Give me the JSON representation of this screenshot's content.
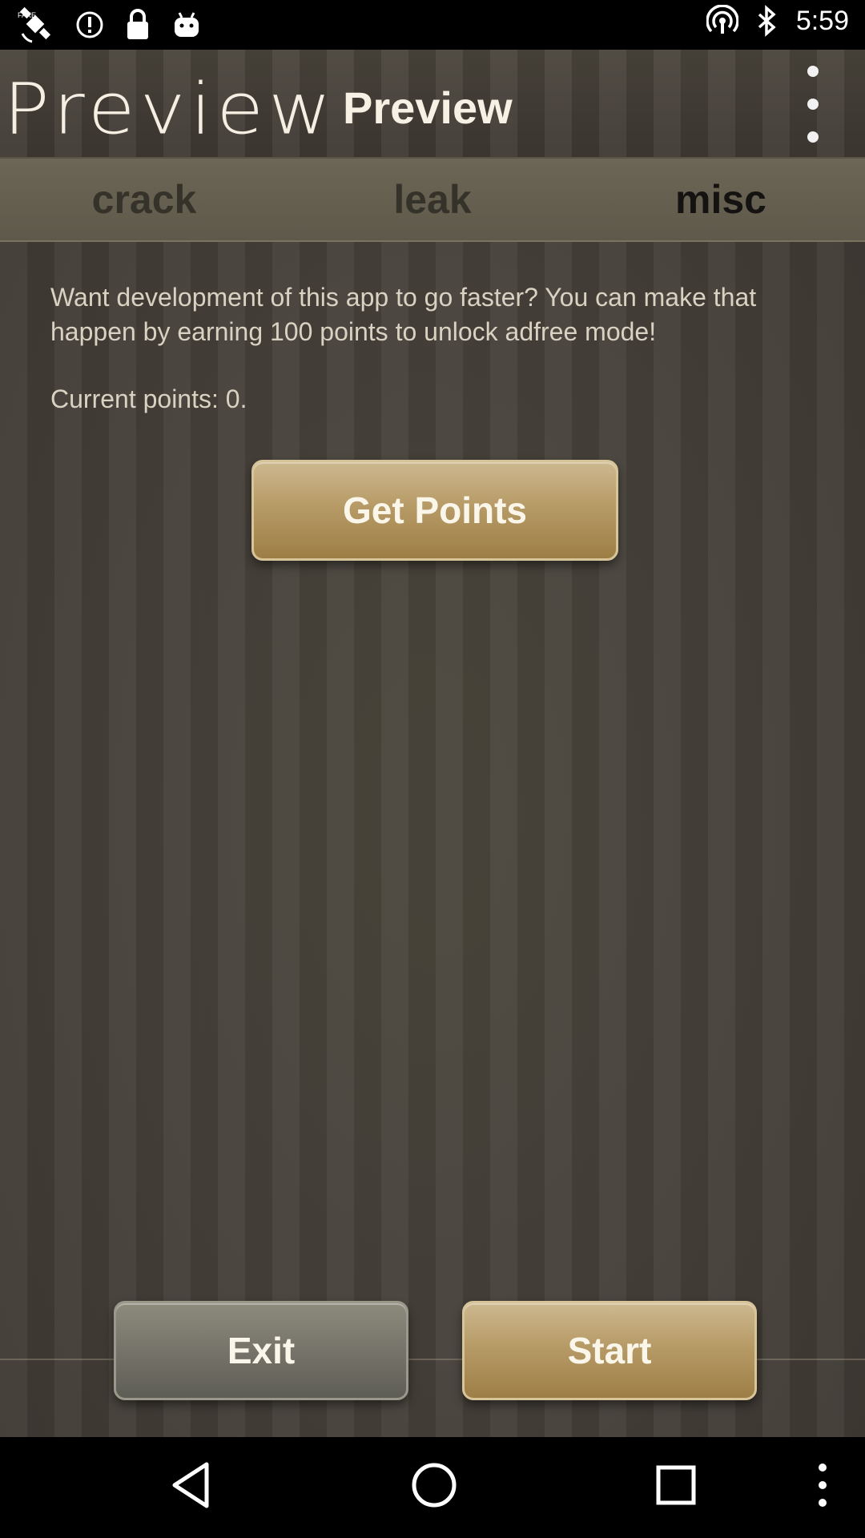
{
  "status_bar": {
    "time": "5:59",
    "left_icons": [
      "satellite-icon",
      "alert-circle-icon",
      "lock-icon",
      "android-icon"
    ],
    "right_icons": [
      "hotspot-icon",
      "bluetooth-icon"
    ]
  },
  "header": {
    "logo_text": "Preview",
    "title": "Preview"
  },
  "tabs": [
    {
      "label": "crack",
      "active": false
    },
    {
      "label": "leak",
      "active": false
    },
    {
      "label": "misc",
      "active": true
    }
  ],
  "content": {
    "message": "Want development of this app to go faster? You can make that happen by earning 100 points to unlock adfree mode!",
    "points_text": "Current points: 0.",
    "get_points_label": "Get Points"
  },
  "footer": {
    "exit_label": "Exit",
    "start_label": "Start"
  },
  "colors": {
    "gold_button": "#b79b67",
    "grey_button": "#76746a",
    "background": "#46413a",
    "tab_bar": "#655f50"
  }
}
